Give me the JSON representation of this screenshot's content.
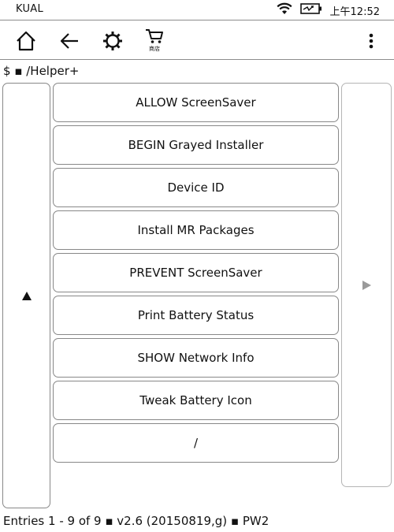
{
  "status_bar": {
    "app_title": "KUAL",
    "time": "上午12:52",
    "icons": [
      "wifi-icon",
      "battery-charging-icon"
    ]
  },
  "toolbar": {
    "icons": [
      "home-icon",
      "back-arrow-icon",
      "settings-gear-icon",
      "store-cart-icon"
    ],
    "store_label": "商店",
    "menu_icon": "more-vertical-icon"
  },
  "path": "$ ▪ /Helper+",
  "menu": {
    "items": [
      {
        "label": "ALLOW ScreenSaver"
      },
      {
        "label": "BEGIN Grayed Installer"
      },
      {
        "label": "Device ID"
      },
      {
        "label": "Install MR Packages"
      },
      {
        "label": "PREVENT ScreenSaver"
      },
      {
        "label": "Print Battery Status"
      },
      {
        "label": "SHOW Network Info"
      },
      {
        "label": "Tweak Battery Icon"
      },
      {
        "label": "/"
      }
    ]
  },
  "nav": {
    "prev_icon": "up-triangle-icon",
    "next_icon": "right-triangle-icon"
  },
  "footer": "Entries 1 - 9 of 9 ▪ v2.6 (20150819,g) ▪ PW2",
  "colors": {
    "border": "#888888",
    "text": "#111111",
    "disabled": "#9a9a9a"
  }
}
